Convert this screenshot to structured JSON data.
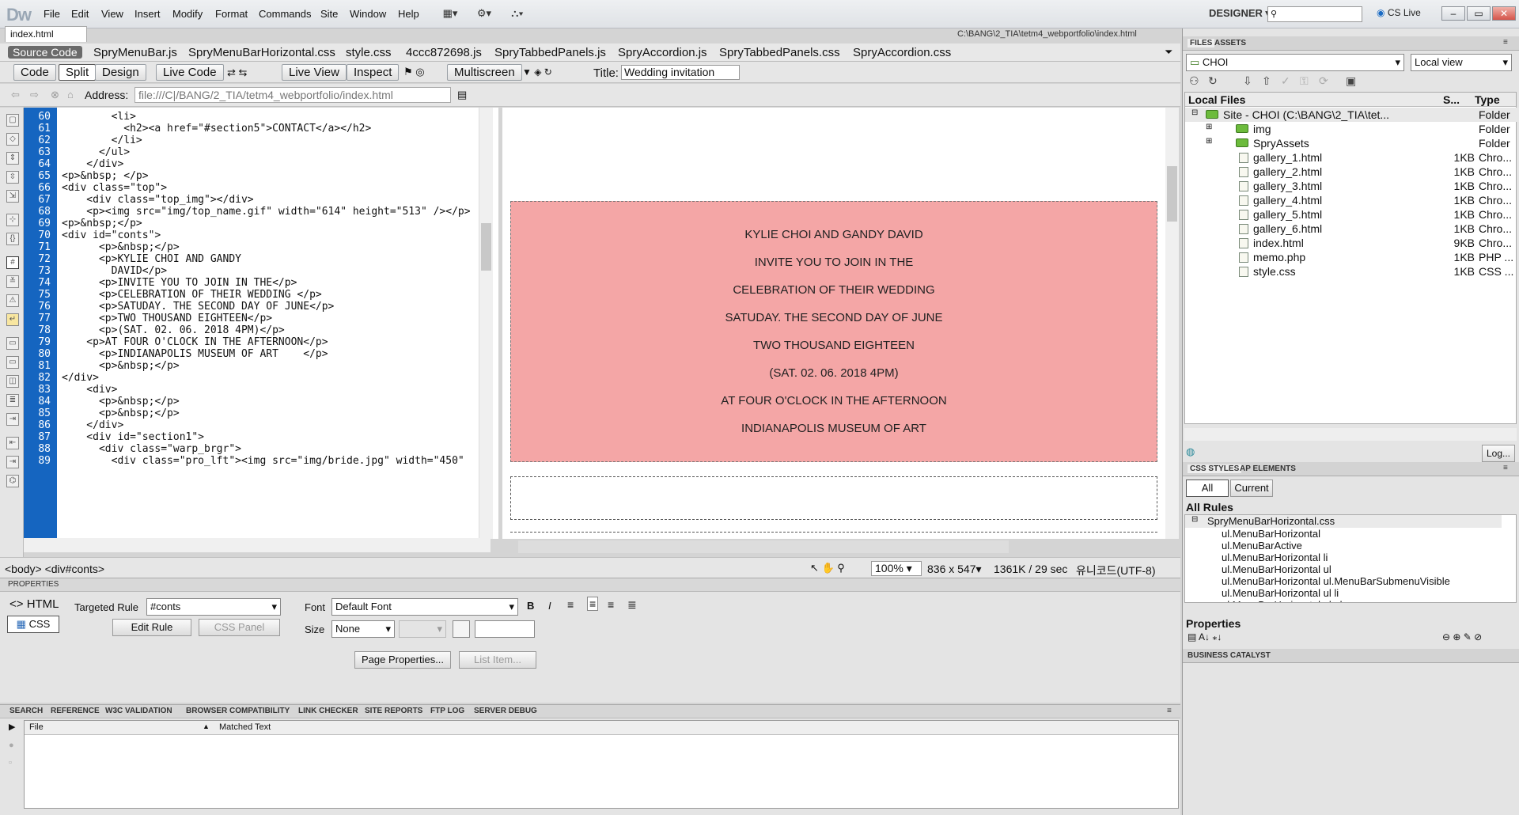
{
  "app": {
    "logo": "Dw"
  },
  "menu": [
    "File",
    "Edit",
    "View",
    "Insert",
    "Modify",
    "Format",
    "Commands",
    "Site",
    "Window",
    "Help"
  ],
  "workspace": {
    "designer_label": "DESIGNER",
    "cslive_label": "CS Live"
  },
  "document": {
    "tab_label": "index.html",
    "path": "C:\\BANG\\2_TIA\\tetm4_webportfolio\\index.html",
    "source_code_label": "Source Code",
    "related_files": [
      "SpryMenuBar.js",
      "SpryMenuBarHorizontal.css",
      "style.css",
      "4ccc872698.js",
      "SpryTabbedPanels.js",
      "SpryAccordion.js",
      "SpryTabbedPanels.css",
      "SpryAccordion.css"
    ]
  },
  "toolbar": {
    "code_label": "Code",
    "split_label": "Split",
    "design_label": "Design",
    "live_code_label": "Live Code",
    "live_view_label": "Live View",
    "inspect_label": "Inspect",
    "multiscreen_label": "Multiscreen",
    "title_label": "Title:",
    "title_value": "Wedding invitation"
  },
  "address": {
    "label": "Address:",
    "value": "file:///C|/BANG/2_TIA/tetm4_webportfolio/index.html"
  },
  "code": {
    "line_numbers": [
      "60",
      "61",
      "62",
      "63",
      "64",
      "65",
      "66",
      "67",
      "68",
      "69",
      "70",
      "71",
      "72",
      "73",
      "74",
      "75",
      "76",
      "77",
      "78",
      "79",
      "80",
      "81",
      "82",
      "83",
      "84",
      "85",
      "86",
      "87",
      "88",
      "89"
    ],
    "lines": [
      "        <li>",
      "          <h2><a href=\"#section5\">CONTACT</a></h2>",
      "        </li>",
      "      </ul>",
      "    </div>",
      "<p>&nbsp; </p>",
      "<div class=\"top\">",
      "    <div class=\"top_img\"></div>",
      "    <p><img src=\"img/top_name.gif\" width=\"614\" height=\"513\" /></p>",
      "<p>&nbsp;</p>",
      "<div id=\"conts\">",
      "      <p>&nbsp;</p>",
      "      <p>KYLIE CHOI AND GANDY",
      "        DAVID</p>",
      "      <p>INVITE YOU TO JOIN IN THE</p>",
      "      <p>CELEBRATION OF THEIR WEDDING </p>",
      "      <p>SATUDAY. THE SECOND DAY OF JUNE</p>",
      "      <p>TWO THOUSAND EIGHTEEN</p>",
      "      <p>(SAT. 02. 06. 2018 4PM)</p>",
      "    <p>AT FOUR O'CLOCK IN THE AFTERNOON</p>",
      "      <p>INDIANAPOLIS MUSEUM OF ART    </p>",
      "      <p>&nbsp;</p>",
      "</div>",
      "    <div>",
      "      <p>&nbsp;</p>",
      "      <p>&nbsp;</p>",
      "    </div>",
      "    <div id=\"section1\">",
      "      <div class=\"warp_brgr\">",
      "        <div class=\"pro_lft\"><img src=\"img/bride.jpg\" width=\"450\""
    ]
  },
  "design": {
    "conts_lines": [
      "KYLIE CHOI AND GANDY DAVID",
      "INVITE YOU TO JOIN IN THE",
      "CELEBRATION OF THEIR WEDDING",
      "SATUDAY. THE SECOND DAY OF JUNE",
      "TWO THOUSAND EIGHTEEN",
      "(SAT. 02. 06. 2018 4PM)",
      "AT FOUR O'CLOCK IN THE AFTERNOON",
      "INDIANAPOLIS MUSEUM OF ART"
    ],
    "conts_bg": "#f4a6a6"
  },
  "status": {
    "tag_selector": "<body> <div#conts>",
    "zoom": "100%",
    "dimensions": "836 x 547",
    "download": "1361K / 29 sec",
    "encoding": "유니코드(UTF-8)"
  },
  "properties": {
    "header": "PROPERTIES",
    "html_label": "HTML",
    "css_label": "CSS",
    "targeted_rule_label": "Targeted Rule",
    "targeted_rule_value": "#conts",
    "edit_rule_label": "Edit Rule",
    "css_panel_label": "CSS Panel",
    "font_label": "Font",
    "font_value": "Default Font",
    "size_label": "Size",
    "size_value": "None",
    "page_properties_label": "Page Properties...",
    "list_item_label": "List Item..."
  },
  "results": {
    "tabs": [
      "SEARCH",
      "REFERENCE",
      "W3C VALIDATION",
      "BROWSER COMPATIBILITY",
      "LINK CHECKER",
      "SITE REPORTS",
      "FTP LOG",
      "SERVER DEBUG"
    ],
    "col_file": "File",
    "col_matched": "Matched Text"
  },
  "files_panel": {
    "tabs": [
      "FILES",
      "ASSETS"
    ],
    "site_select": "CHOI",
    "view_select": "Local view",
    "col_local": "Local Files",
    "col_size": "S...",
    "col_type": "Type",
    "root": {
      "name": "Site - CHOI (C:\\BANG\\2_TIA\\tet...",
      "type": "Folder"
    },
    "items": [
      {
        "name": "img",
        "size": "",
        "type": "Folder",
        "folder": true
      },
      {
        "name": "SpryAssets",
        "size": "",
        "type": "Folder",
        "folder": true
      },
      {
        "name": "gallery_1.html",
        "size": "1KB",
        "type": "Chro..."
      },
      {
        "name": "gallery_2.html",
        "size": "1KB",
        "type": "Chro..."
      },
      {
        "name": "gallery_3.html",
        "size": "1KB",
        "type": "Chro..."
      },
      {
        "name": "gallery_4.html",
        "size": "1KB",
        "type": "Chro..."
      },
      {
        "name": "gallery_5.html",
        "size": "1KB",
        "type": "Chro..."
      },
      {
        "name": "gallery_6.html",
        "size": "1KB",
        "type": "Chro..."
      },
      {
        "name": "index.html",
        "size": "9KB",
        "type": "Chro..."
      },
      {
        "name": "memo.php",
        "size": "1KB",
        "type": "PHP ..."
      },
      {
        "name": "style.css",
        "size": "1KB",
        "type": "CSS ..."
      }
    ],
    "log_label": "Log..."
  },
  "css_panel": {
    "tabs": [
      "CSS STYLES",
      "AP ELEMENTS"
    ],
    "all_label": "All",
    "current_label": "Current",
    "all_rules_label": "All Rules",
    "sheet": "SpryMenuBarHorizontal.css",
    "rules": [
      "ul.MenuBarHorizontal",
      "ul.MenuBarActive",
      "ul.MenuBarHorizontal li",
      "ul.MenuBarHorizontal ul",
      "ul.MenuBarHorizontal ul.MenuBarSubmenuVisible",
      "ul.MenuBarHorizontal ul li",
      "ul.MenuBarHorizontal ul ul"
    ],
    "properties_label": "Properties"
  },
  "business_catalyst": "BUSINESS CATALYST"
}
